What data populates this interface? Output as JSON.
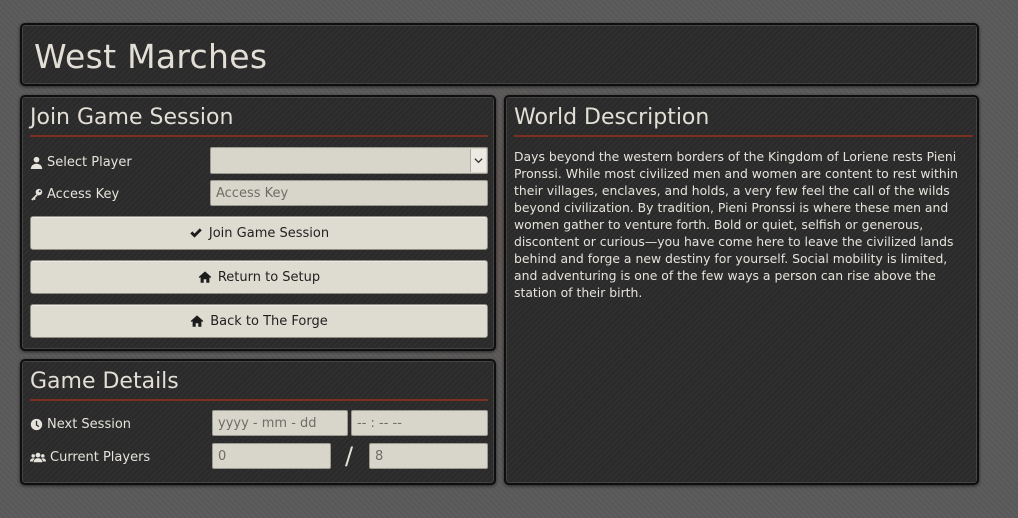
{
  "header": {
    "title": "West Marches"
  },
  "join": {
    "title": "Join Game Session",
    "select_player_label": "Select Player",
    "select_player_value": "",
    "access_key_label": "Access Key",
    "access_key_placeholder": "Access Key",
    "join_button": "Join Game Session",
    "return_button": "Return to Setup",
    "forge_button": "Back to The Forge"
  },
  "details": {
    "title": "Game Details",
    "next_session_label": "Next Session",
    "date_placeholder": "yyyy - mm - dd",
    "time_placeholder": "-- : --  --",
    "current_players_label": "Current Players",
    "current_players_value": "0",
    "slash": "/",
    "max_players_value": "8"
  },
  "world": {
    "title": "World Description",
    "text": "Days beyond the western borders of the Kingdom of Loriene rests Pieni Pronssi. While most civilized men and women are content to rest within their villages, enclaves, and holds, a very few feel the call of the wilds beyond civilization. By tradition, Pieni Pronssi is where these men and women gather to venture forth. Bold or quiet, selfish or generous, discontent or curious—you have come here to leave the civilized lands behind and forge a new destiny for yourself. Social mobility is limited, and adventuring is one of the few ways a person can rise above the station of their birth."
  },
  "colors": {
    "accent_rule": "#7a2f1f",
    "panel_bg": "#2b2b2b",
    "button_bg": "#dedbd0",
    "input_bg": "#d8d6cb"
  },
  "icons": [
    "user-icon",
    "key-icon",
    "check-icon",
    "home-icon",
    "clock-icon",
    "users-icon",
    "chevron-down-icon"
  ]
}
